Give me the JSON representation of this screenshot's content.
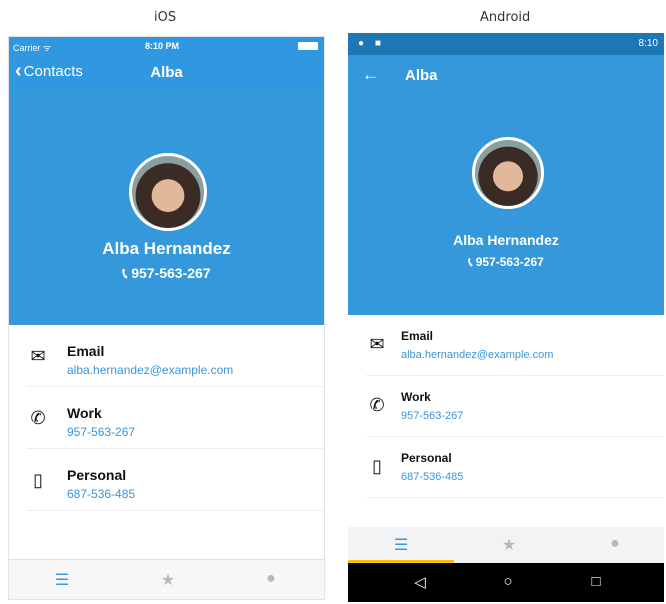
{
  "labels": {
    "ios": "iOS",
    "android": "Android"
  },
  "ios": {
    "status": {
      "carrier": "Carrier ᯤ",
      "time": "8:10 PM"
    },
    "nav": {
      "back_label": "Contacts",
      "title": "Alba"
    },
    "contact": {
      "name": "Alba Hernandez",
      "phone": "957-563-267"
    },
    "rows": [
      {
        "icon": "mail-icon",
        "label": "Email",
        "value": "alba.hernandez@example.com"
      },
      {
        "icon": "phone-icon",
        "label": "Work",
        "value": "957-563-267"
      },
      {
        "icon": "mobile-icon",
        "label": "Personal",
        "value": "687-536-485"
      }
    ]
  },
  "android": {
    "status": {
      "time": "8:10"
    },
    "toolbar": {
      "title": "Alba"
    },
    "contact": {
      "name": "Alba Hernandez",
      "phone": "957-563-267"
    },
    "rows": [
      {
        "icon": "mail-icon",
        "label": "Email",
        "value": "alba.hernandez@example.com"
      },
      {
        "icon": "phone-icon",
        "label": "Work",
        "value": "957-563-267"
      },
      {
        "icon": "mobile-icon",
        "label": "Personal",
        "value": "687-536-485"
      }
    ]
  },
  "colors": {
    "header": "#3498db",
    "link": "#3b95d6",
    "tab_indicator": "#f4c20d"
  }
}
